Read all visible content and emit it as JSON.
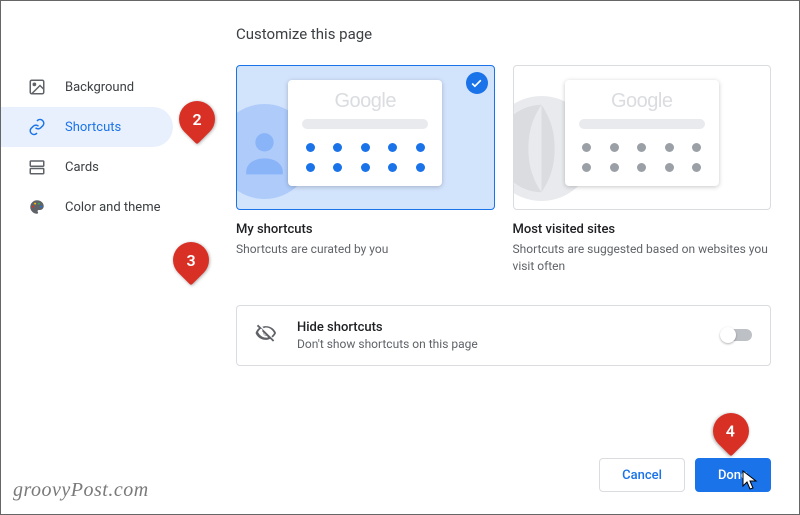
{
  "title": "Customize this page",
  "sidebar": {
    "items": [
      {
        "label": "Background"
      },
      {
        "label": "Shortcuts"
      },
      {
        "label": "Cards"
      },
      {
        "label": "Color and theme"
      }
    ]
  },
  "options": {
    "my_shortcuts": {
      "title": "My shortcuts",
      "desc": "Shortcuts are curated by you",
      "logo": "Google"
    },
    "most_visited": {
      "title": "Most visited sites",
      "desc": "Shortcuts are suggested based on websites you visit often",
      "logo": "Google"
    }
  },
  "hide": {
    "title": "Hide shortcuts",
    "desc": "Don't show shortcuts on this page"
  },
  "buttons": {
    "cancel": "Cancel",
    "done": "Done"
  },
  "annotations": {
    "b2": "2",
    "b3": "3",
    "b4": "4"
  },
  "watermark": "groovyPost.com"
}
